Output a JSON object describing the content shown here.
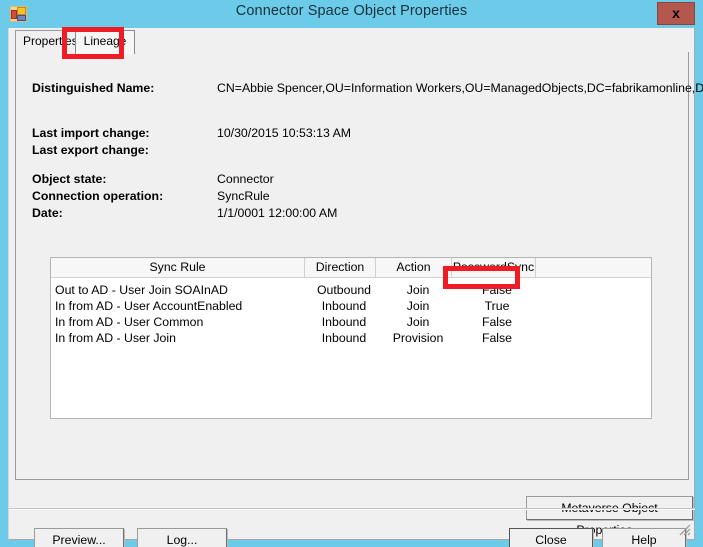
{
  "window": {
    "title": "Connector Space Object Properties",
    "app_icon": "connector-space-icon",
    "close_label": "x",
    "titlebar_color": "#6ccbe8",
    "close_button_color": "#b4574f",
    "annotation_color": "#ee1c24"
  },
  "tabs": [
    {
      "label": "Properties",
      "active": false
    },
    {
      "label": "Lineage",
      "active": true
    }
  ],
  "details": {
    "distinguished_name": {
      "label": "Distinguished Name:",
      "value": "CN=Abbie Spencer,OU=Information Workers,OU=ManagedObjects,DC=fabrikamonline,DC=com"
    },
    "last_import_change": {
      "label": "Last import change:",
      "value": "10/30/2015 10:53:13 AM"
    },
    "last_export_change": {
      "label": "Last export change:",
      "value": ""
    },
    "object_state": {
      "label": "Object state:",
      "value": "Connector"
    },
    "connection_operation": {
      "label": "Connection operation:",
      "value": "SyncRule"
    },
    "date": {
      "label": "Date:",
      "value": "1/1/0001 12:00:00 AM"
    }
  },
  "grid": {
    "columns": [
      "Sync Rule",
      "Direction",
      "Action",
      "PasswordSync",
      ""
    ],
    "rows": [
      {
        "sync_rule": "Out to AD - User Join SOAInAD",
        "direction": "Outbound",
        "action": "Join",
        "password_sync": "False"
      },
      {
        "sync_rule": "In from AD - User AccountEnabled",
        "direction": "Inbound",
        "action": "Join",
        "password_sync": "True"
      },
      {
        "sync_rule": "In from AD - User Common",
        "direction": "Inbound",
        "action": "Join",
        "password_sync": "False"
      },
      {
        "sync_rule": "In from AD - User Join",
        "direction": "Inbound",
        "action": "Provision",
        "password_sync": "False"
      }
    ]
  },
  "buttons": {
    "metaverse": "Metaverse Object Properties...",
    "preview": "Preview...",
    "log": "Log...",
    "close": "Close",
    "help": "Help"
  }
}
